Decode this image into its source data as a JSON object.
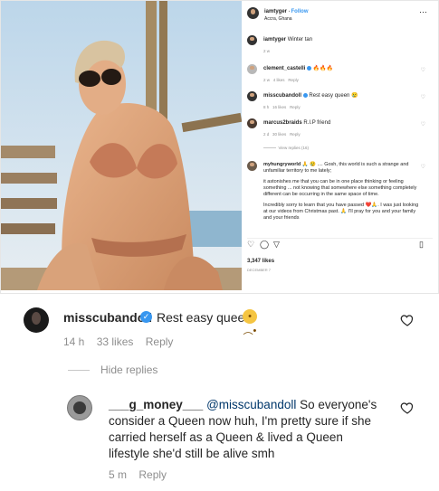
{
  "post": {
    "author": "iamtyger",
    "follow_label": "Follow",
    "location": "Accra, Ghana",
    "caption_user": "iamtyger",
    "caption_text": "Winter tan",
    "caption_age": "2 w",
    "likes": "3,347 likes",
    "date": "DECEMBER 7",
    "comments": [
      {
        "user": "clement_castelli",
        "text": "🔥🔥🔥",
        "age": "2 w",
        "likes": "4 likes",
        "reply": "Reply"
      },
      {
        "user": "misscubandoll",
        "text": "Rest easy queen 😢",
        "age": "8 h",
        "likes": "16 likes",
        "reply": "Reply"
      },
      {
        "user": "marcus2braids",
        "text": "R.I.P friend",
        "age": "2 d",
        "likes": "30 likes",
        "reply": "Reply",
        "view_replies": "View replies (16)"
      },
      {
        "user": "myhungryworld",
        "text": "🙏 😢 .... Gosh, this world is such a strange and unfamiliar territory to me lately;",
        "extra1": "it astonishes me that you can be in one place thinking or feeling something ... not knowing that somewhere else something completely different can be occurring in the same space of time.",
        "extra2": "Incredibly sorry to learn that you have passed ❤️🙏. I was just looking at our videos from Christmas past. 🙏 I'll pray for you and your family and your friends"
      }
    ]
  },
  "reply_thread": {
    "comment": {
      "user": "misscubandoll",
      "text": "Rest easy queen",
      "emoji": "😢",
      "age": "14 h",
      "likes": "33 likes",
      "reply": "Reply"
    },
    "hide_replies": "Hide replies",
    "reply": {
      "user": "___g_money___",
      "mention": "@misscubandoll",
      "text": "So everyone's consider a Queen now huh, I'm pretty sure if she carried herself as a Queen & lived a Queen lifestyle she'd still be alive smh",
      "age": "5 m",
      "reply": "Reply"
    }
  },
  "colors": {
    "link_blue": "#3897f0",
    "mention": "#00376b",
    "muted": "#8e8e8e"
  },
  "icons": [
    "heart-icon",
    "comment-icon",
    "share-icon",
    "bookmark-icon",
    "more-icon",
    "verified-icon"
  ]
}
